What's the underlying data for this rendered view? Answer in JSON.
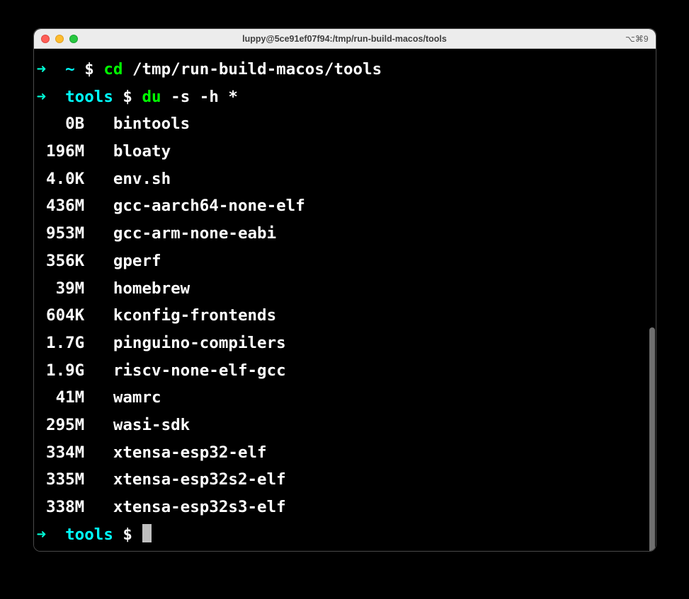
{
  "window": {
    "title": "luppy@5ce91ef07f94:/tmp/run-build-macos/tools",
    "shortcut": "⌥⌘9"
  },
  "prompts": [
    {
      "arrow": "➜",
      "cwd": "~",
      "dollar": "$",
      "cmd": "cd",
      "args": "/tmp/run-build-macos/tools"
    },
    {
      "arrow": "➜",
      "cwd": "tools",
      "dollar": "$",
      "cmd": "du",
      "args": "-s -h *"
    }
  ],
  "output": [
    {
      "size": "0B",
      "name": "bintools"
    },
    {
      "size": "196M",
      "name": "bloaty"
    },
    {
      "size": "4.0K",
      "name": "env.sh"
    },
    {
      "size": "436M",
      "name": "gcc-aarch64-none-elf"
    },
    {
      "size": "953M",
      "name": "gcc-arm-none-eabi"
    },
    {
      "size": "356K",
      "name": "gperf"
    },
    {
      "size": "39M",
      "name": "homebrew"
    },
    {
      "size": "604K",
      "name": "kconfig-frontends"
    },
    {
      "size": "1.7G",
      "name": "pinguino-compilers"
    },
    {
      "size": "1.9G",
      "name": "riscv-none-elf-gcc"
    },
    {
      "size": "41M",
      "name": "wamrc"
    },
    {
      "size": "295M",
      "name": "wasi-sdk"
    },
    {
      "size": "334M",
      "name": "xtensa-esp32-elf"
    },
    {
      "size": "335M",
      "name": "xtensa-esp32s2-elf"
    },
    {
      "size": "338M",
      "name": "xtensa-esp32s3-elf"
    }
  ],
  "final_prompt": {
    "arrow": "➜",
    "cwd": "tools",
    "dollar": "$"
  }
}
